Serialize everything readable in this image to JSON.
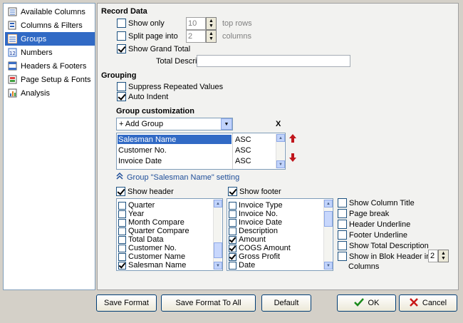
{
  "sidebar": {
    "items": [
      {
        "label": "Available Columns",
        "icon": "columns-list-icon"
      },
      {
        "label": "Columns & Filters",
        "icon": "filter-doc-icon"
      },
      {
        "label": "Groups",
        "icon": "groups-icon",
        "selected": true
      },
      {
        "label": "Numbers",
        "icon": "numbers-icon"
      },
      {
        "label": "Headers & Footers",
        "icon": "headers-icon"
      },
      {
        "label": "Page Setup & Fonts",
        "icon": "page-setup-icon"
      },
      {
        "label": "Analysis",
        "icon": "analysis-icon"
      }
    ]
  },
  "record_data": {
    "title": "Record Data",
    "show_only_label": "Show only",
    "show_only_value": "10",
    "top_rows_label": "top rows",
    "split_page_label": "Split page into",
    "split_page_value": "2",
    "columns_label": "columns",
    "show_grand_total_label": "Show Grand Total",
    "total_description_label": "Total Description :",
    "total_description_value": ""
  },
  "grouping": {
    "title": "Grouping",
    "suppress_label": "Suppress Repeated Values",
    "auto_indent_label": "Auto Indent",
    "customization_title": "Group customization",
    "add_group_label": "+ Add Group",
    "remove_label": "X",
    "groups": [
      {
        "name": "Salesman Name",
        "order": "ASC"
      },
      {
        "name": "Customer No.",
        "order": "ASC"
      },
      {
        "name": "Invoice Date",
        "order": "ASC"
      }
    ],
    "setting_link": "Group \"Salesman Name\" setting"
  },
  "settings": {
    "show_header_label": "Show header",
    "show_footer_label": "Show footer",
    "header_items": [
      {
        "label": "Quarter",
        "checked": false
      },
      {
        "label": "Year",
        "checked": false
      },
      {
        "label": "Month Compare",
        "checked": false
      },
      {
        "label": "Quarter Compare",
        "checked": false
      },
      {
        "label": "Total Data",
        "checked": false
      },
      {
        "label": "Customer No.",
        "checked": false
      },
      {
        "label": "Customer Name",
        "checked": false
      },
      {
        "label": "Salesman Name",
        "checked": true
      }
    ],
    "footer_items": [
      {
        "label": "Invoice Type",
        "checked": false
      },
      {
        "label": "Invoice No.",
        "checked": false
      },
      {
        "label": "Invoice Date",
        "checked": false
      },
      {
        "label": "Description",
        "checked": false
      },
      {
        "label": "Amount",
        "checked": true
      },
      {
        "label": "COGS Amount",
        "checked": true
      },
      {
        "label": "Gross Profit",
        "checked": true
      },
      {
        "label": "Date",
        "checked": false
      }
    ],
    "options": {
      "show_column_title": "Show Column Title",
      "page_break": "Page break",
      "header_underline": "Header Underline",
      "footer_underline": "Footer Underline",
      "show_total_description": "Show Total Description",
      "show_in_blok_header": "Show in Blok Header in",
      "columns": "Columns",
      "blok_value": "2"
    }
  },
  "buttons": {
    "save_format": "Save Format",
    "save_format_all": "Save Format To All",
    "default": "Default",
    "ok": "OK",
    "cancel": "Cancel"
  },
  "colors": {
    "selection": "#316ac5",
    "link": "#1f4e99",
    "ok_check": "#1a8a1a",
    "cancel_x": "#c81818",
    "arrow_red": "#c0161c"
  }
}
